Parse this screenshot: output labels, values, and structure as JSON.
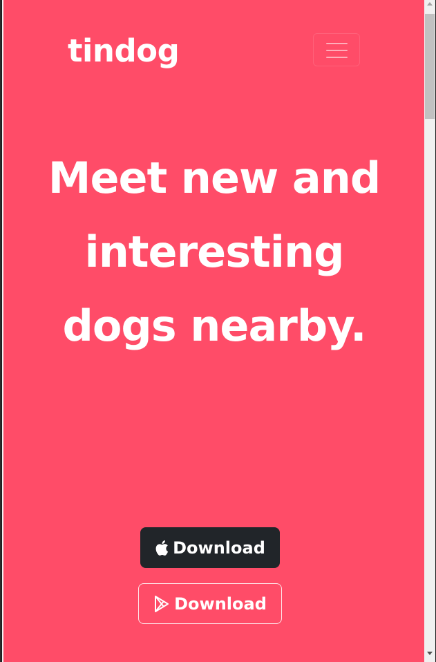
{
  "navbar": {
    "brand": "tindog",
    "menu_icon": "hamburger-menu-icon"
  },
  "hero": {
    "headline": "Meet new and interesting dogs nearby.",
    "buttons": [
      {
        "label": "Download",
        "icon": "apple-icon",
        "style": "dark"
      },
      {
        "label": "Download",
        "icon": "google-play-icon",
        "style": "outline"
      }
    ]
  },
  "colors": {
    "background": "#ff4c68",
    "button_dark": "#212529",
    "text": "#ffffff"
  }
}
